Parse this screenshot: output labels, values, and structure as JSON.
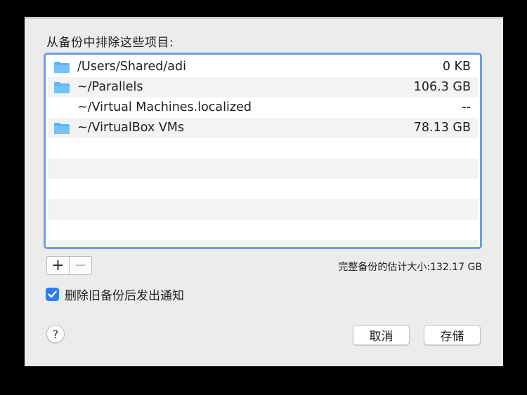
{
  "dialog": {
    "heading": "从备份中排除这些项目:",
    "exclusions": [
      {
        "path": "/Users/Shared/adi",
        "size": "0 KB",
        "icon": "folder-icon"
      },
      {
        "path": "~/Parallels",
        "size": "106.3 GB",
        "icon": "folder-icon"
      },
      {
        "path": "~/Virtual Machines.localized",
        "size": "--",
        "icon": ""
      },
      {
        "path": "~/VirtualBox VMs",
        "size": "78.13 GB",
        "icon": "folder-icon"
      }
    ],
    "add_label": "+",
    "remove_label": "−",
    "estimate": "完整备份的估计大小:132.17 GB",
    "notify_checkbox": {
      "label": "删除旧备份后发出通知",
      "checked": true
    },
    "help_label": "?",
    "cancel_label": "取消",
    "save_label": "存储"
  },
  "colors": {
    "accent": "#2f7bf0",
    "focus_ring": "#6f9de6",
    "folder": "#5fb3f3"
  }
}
